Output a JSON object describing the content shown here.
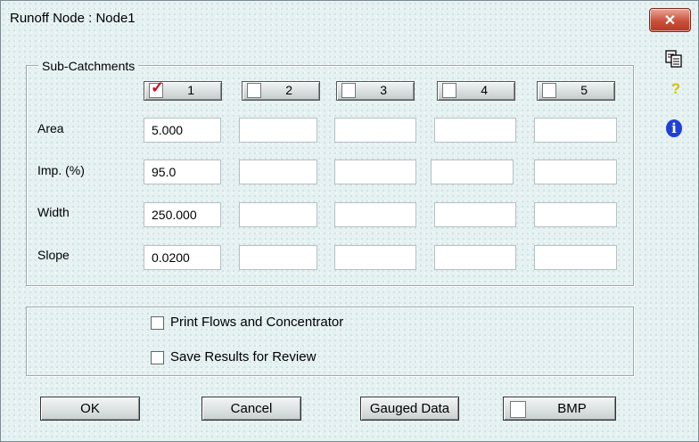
{
  "window": {
    "title": "Runoff Node : Node1",
    "close_glyph": "✕"
  },
  "side_icons": [
    {
      "name": "copy-icon"
    },
    {
      "name": "help-icon",
      "glyph": "?"
    },
    {
      "name": "info-icon",
      "glyph": "i"
    }
  ],
  "subcatchments": {
    "legend": "Sub-Catchments",
    "buttons": [
      {
        "label": "1",
        "checked": true
      },
      {
        "label": "2",
        "checked": false
      },
      {
        "label": "3",
        "checked": false
      },
      {
        "label": "4",
        "checked": false
      },
      {
        "label": "5",
        "checked": false
      }
    ],
    "rows": [
      {
        "label": "Area",
        "values": [
          "5.000",
          "",
          "",
          "",
          ""
        ]
      },
      {
        "label": "Imp. (%)",
        "values": [
          "95.0",
          "",
          "",
          "",
          ""
        ]
      },
      {
        "label": "Width",
        "values": [
          "250.000",
          "",
          "",
          "",
          ""
        ]
      },
      {
        "label": "Slope",
        "values": [
          "0.0200",
          "",
          "",
          "",
          ""
        ]
      }
    ]
  },
  "options": {
    "print_flows": {
      "label": "Print Flows and Concentrator",
      "checked": false
    },
    "save_results": {
      "label": "Save Results for Review",
      "checked": false
    }
  },
  "buttons": {
    "ok": "OK",
    "cancel": "Cancel",
    "gauged": "Gauged Data",
    "bmp": "BMP"
  },
  "colors": {
    "close_red": "#c9503a",
    "info_blue": "#1f3fd8",
    "check_red": "#c8101a",
    "help_yellow": "#d8c200"
  }
}
